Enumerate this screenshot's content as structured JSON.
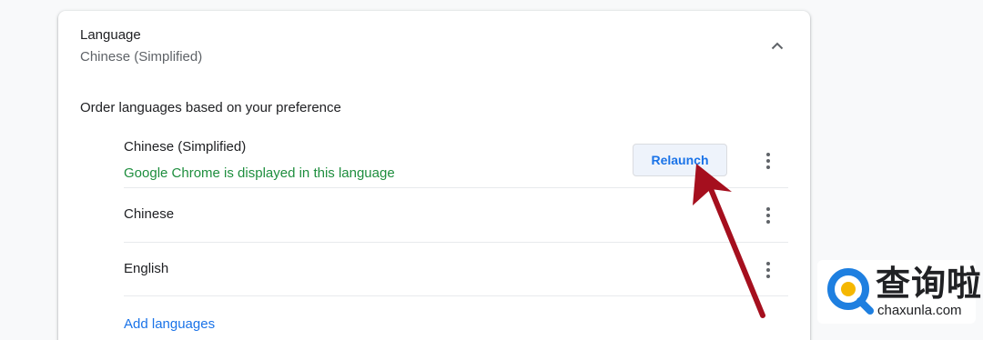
{
  "section": {
    "title": "Language",
    "subtitle": "Chinese (Simplified)"
  },
  "order_label": "Order languages based on your preference",
  "languages": [
    {
      "name": "Chinese (Simplified)",
      "note": "Google Chrome is displayed in this language",
      "action_label": "Relaunch"
    },
    {
      "name": "Chinese"
    },
    {
      "name": "English"
    }
  ],
  "add_languages_label": "Add languages",
  "icons": {
    "collapse": "chevron-up-icon",
    "more": "more-vert-icon",
    "annotation": "red-arrow"
  },
  "colors": {
    "accent": "#1a73e8",
    "note_green": "#1e8e3e",
    "arrow_red": "#a50f1e",
    "watermark_blue": "#1e7fe0"
  },
  "watermark": {
    "chinese": "查询啦",
    "url": "chaxunla.com"
  }
}
